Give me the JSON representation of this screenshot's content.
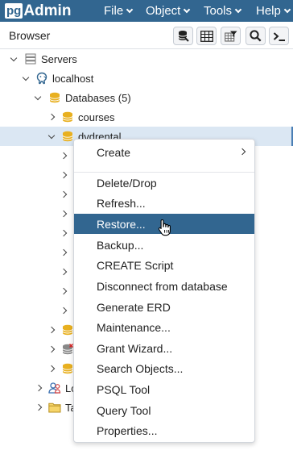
{
  "app": {
    "logo_pg": "pg",
    "logo_admin": "Admin"
  },
  "navbar": {
    "menus": [
      {
        "label": "File"
      },
      {
        "label": "Object"
      },
      {
        "label": "Tools"
      },
      {
        "label": "Help"
      }
    ]
  },
  "panel": {
    "title": "Browser"
  },
  "toolbar": {
    "buttons": [
      "query-tool-icon",
      "view-data-icon",
      "filtered-rows-icon",
      "search-objects-icon",
      "psql-tool-icon"
    ]
  },
  "tree": {
    "servers": "Servers",
    "server": "localhost",
    "databases": "Databases (5)",
    "db_courses": "courses",
    "db_dvdrental": "dvdrental",
    "login_roles_partial": "Lo",
    "tablespaces_partial": "Ta"
  },
  "context_menu": {
    "create": "Create",
    "delete": "Delete/Drop",
    "refresh": "Refresh...",
    "restore": "Restore...",
    "backup": "Backup...",
    "create_script": "CREATE Script",
    "disconnect": "Disconnect from database",
    "erd": "Generate ERD",
    "maintenance": "Maintenance...",
    "grant_wizard": "Grant Wizard...",
    "search_objects": "Search Objects...",
    "psql_tool": "PSQL Tool",
    "query_tool": "Query Tool",
    "properties": "Properties..."
  },
  "colors": {
    "navbar": "#326690",
    "menu_highlight": "#326690",
    "selected_row": "#dbe7f3",
    "database_icon": "#e8b020"
  }
}
